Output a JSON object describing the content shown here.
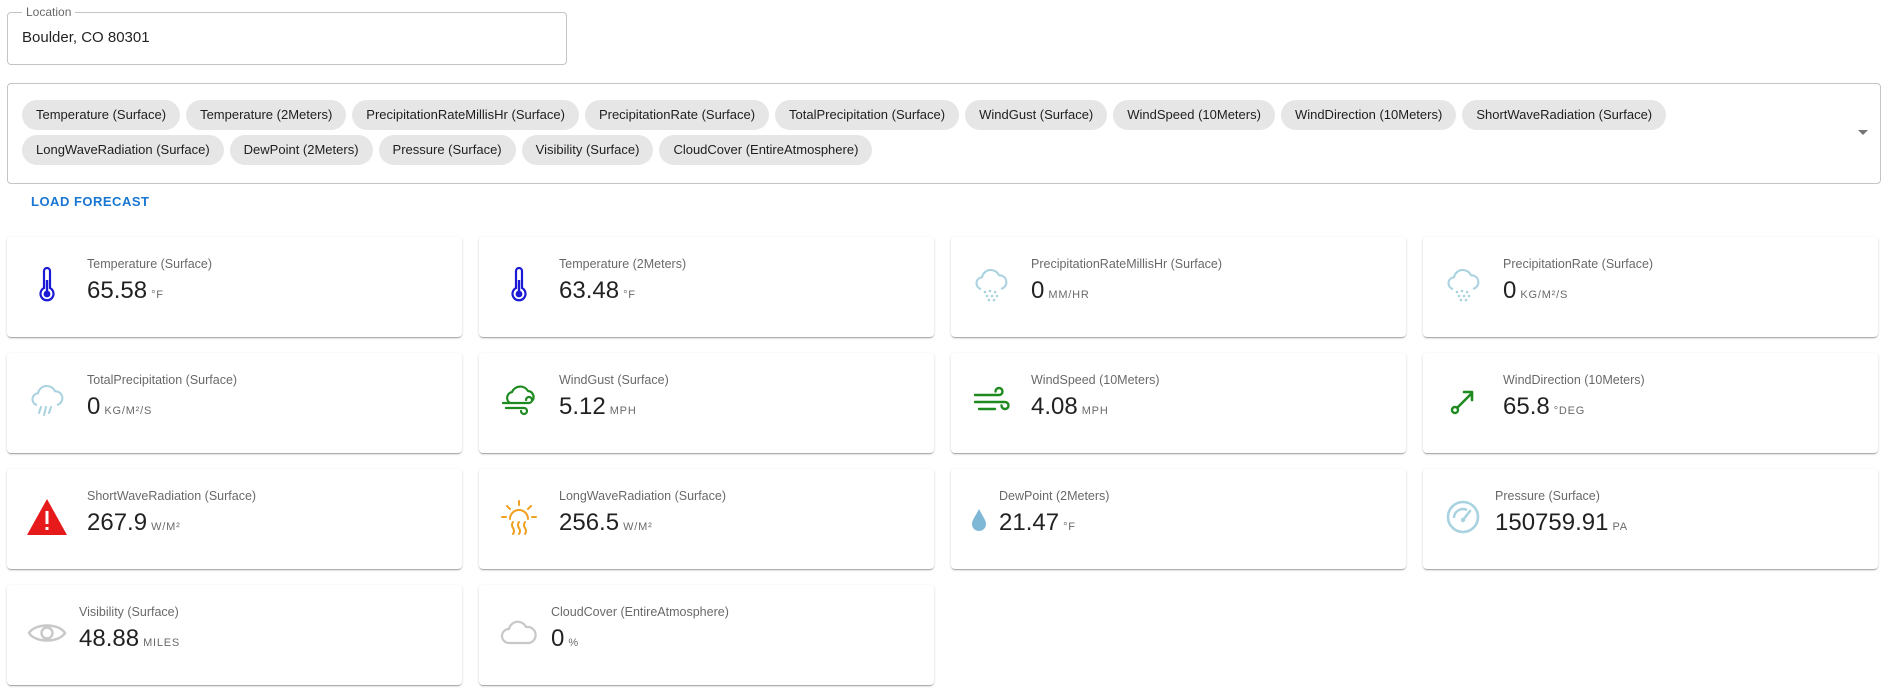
{
  "location": {
    "label": "Location",
    "value": "Boulder, CO 80301"
  },
  "variables": {
    "chips": [
      "Temperature (Surface)",
      "Temperature (2Meters)",
      "PrecipitationRateMillisHr (Surface)",
      "PrecipitationRate (Surface)",
      "TotalPrecipitation (Surface)",
      "WindGust (Surface)",
      "WindSpeed (10Meters)",
      "WindDirection (10Meters)",
      "ShortWaveRadiation (Surface)",
      "LongWaveRadiation (Surface)",
      "DewPoint (2Meters)",
      "Pressure (Surface)",
      "Visibility (Surface)",
      "CloudCover (EntireAtmosphere)"
    ]
  },
  "load_button": {
    "label": "LOAD FORECAST"
  },
  "cards": [
    {
      "label": "Temperature (Surface)",
      "value": "65.58",
      "unit": "°F",
      "icon": "thermometer-icon",
      "color": "#1a1ad6"
    },
    {
      "label": "Temperature (2Meters)",
      "value": "63.48",
      "unit": "°F",
      "icon": "thermometer-icon",
      "color": "#1a1ad6"
    },
    {
      "label": "PrecipitationRateMillisHr (Surface)",
      "value": "0",
      "unit": "MM/HR",
      "icon": "snow-cloud-icon",
      "color": "#a9d2e0"
    },
    {
      "label": "PrecipitationRate (Surface)",
      "value": "0",
      "unit": "KG/M²/S",
      "icon": "snow-cloud-icon",
      "color": "#a9d2e0"
    },
    {
      "label": "TotalPrecipitation (Surface)",
      "value": "0",
      "unit": "KG/M²/S",
      "icon": "rain-cloud-icon",
      "color": "#a9d2e0"
    },
    {
      "label": "WindGust (Surface)",
      "value": "5.12",
      "unit": "MPH",
      "icon": "wind-cloud-icon",
      "color": "#1f8a1f"
    },
    {
      "label": "WindSpeed (10Meters)",
      "value": "4.08",
      "unit": "MPH",
      "icon": "wind-icon",
      "color": "#1f8a1f"
    },
    {
      "label": "WindDirection (10Meters)",
      "value": "65.8",
      "unit": "°DEG",
      "icon": "direction-arrow-icon",
      "color": "#1f8a1f"
    },
    {
      "label": "ShortWaveRadiation (Surface)",
      "value": "267.9",
      "unit": "W/M²",
      "icon": "warning-icon",
      "color": "#e61a1a"
    },
    {
      "label": "LongWaveRadiation (Surface)",
      "value": "256.5",
      "unit": "W/M²",
      "icon": "sun-heat-icon",
      "color": "#f0a020"
    },
    {
      "label": "DewPoint (2Meters)",
      "value": "21.47",
      "unit": "°F",
      "icon": "water-drop-icon",
      "color": "#7fb8d6"
    },
    {
      "label": "Pressure (Surface)",
      "value": "150759.91",
      "unit": "PA",
      "icon": "gauge-icon",
      "color": "#a9d2e0"
    },
    {
      "label": "Visibility (Surface)",
      "value": "48.88",
      "unit": "MILES",
      "icon": "eye-icon",
      "color": "#c8c8c8"
    },
    {
      "label": "CloudCover (EntireAtmosphere)",
      "value": "0",
      "unit": "%",
      "icon": "cloud-icon",
      "color": "#c8c8c8"
    }
  ]
}
